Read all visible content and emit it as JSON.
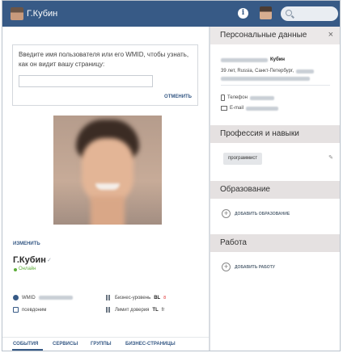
{
  "topbar": {
    "user_name": "Г.Кубин",
    "info_glyph": "i",
    "search_placeholder": ""
  },
  "wmid": {
    "prompt": "Введите имя пользователя или его WMID, чтобы узнать, как он видит вашу страницу:",
    "input_value": "",
    "action_label": "ОТМЕНИТЬ"
  },
  "profile": {
    "change_label": "ИЗМЕНИТЬ",
    "name": "Г.Кубин",
    "status": "Онлайн",
    "wmid_label": "WMID",
    "pseudonym_label": "псевдоним",
    "business_level_label": "Бизнес-уровень",
    "business_level_value": "BL",
    "business_level_badge": "8",
    "trust_limit_label": "Лимит доверия",
    "trust_limit_value": "TL",
    "trust_limit_badge": "fr"
  },
  "tabs": [
    "СОБЫТИЯ",
    "СЕРВИСЫ",
    "ГРУППЫ",
    "БИЗНЕС-СТРАНИЦЫ"
  ],
  "panel": {
    "personal_title": "Персональные данные",
    "close_glyph": "×",
    "full_name_suffix": "Кубин",
    "location": "39 лет, Russia, Санкт-Петербург,",
    "phone_label": "Телефон",
    "email_label": "E-mail",
    "skills_title": "Профессия и навыки",
    "skill": "программист",
    "education_title": "Образование",
    "add_education": "ДОБАВИТЬ ОБРАЗОВАНИЕ",
    "work_title": "Работа",
    "add_work": "ДОБАВИТЬ РАБОТУ",
    "plus_glyph": "+",
    "pencil_glyph": "✎"
  },
  "colors": {
    "topbar": "#375a86",
    "section_header": "#e5e1e1",
    "online": "#5dad3a",
    "link": "#375a86"
  }
}
